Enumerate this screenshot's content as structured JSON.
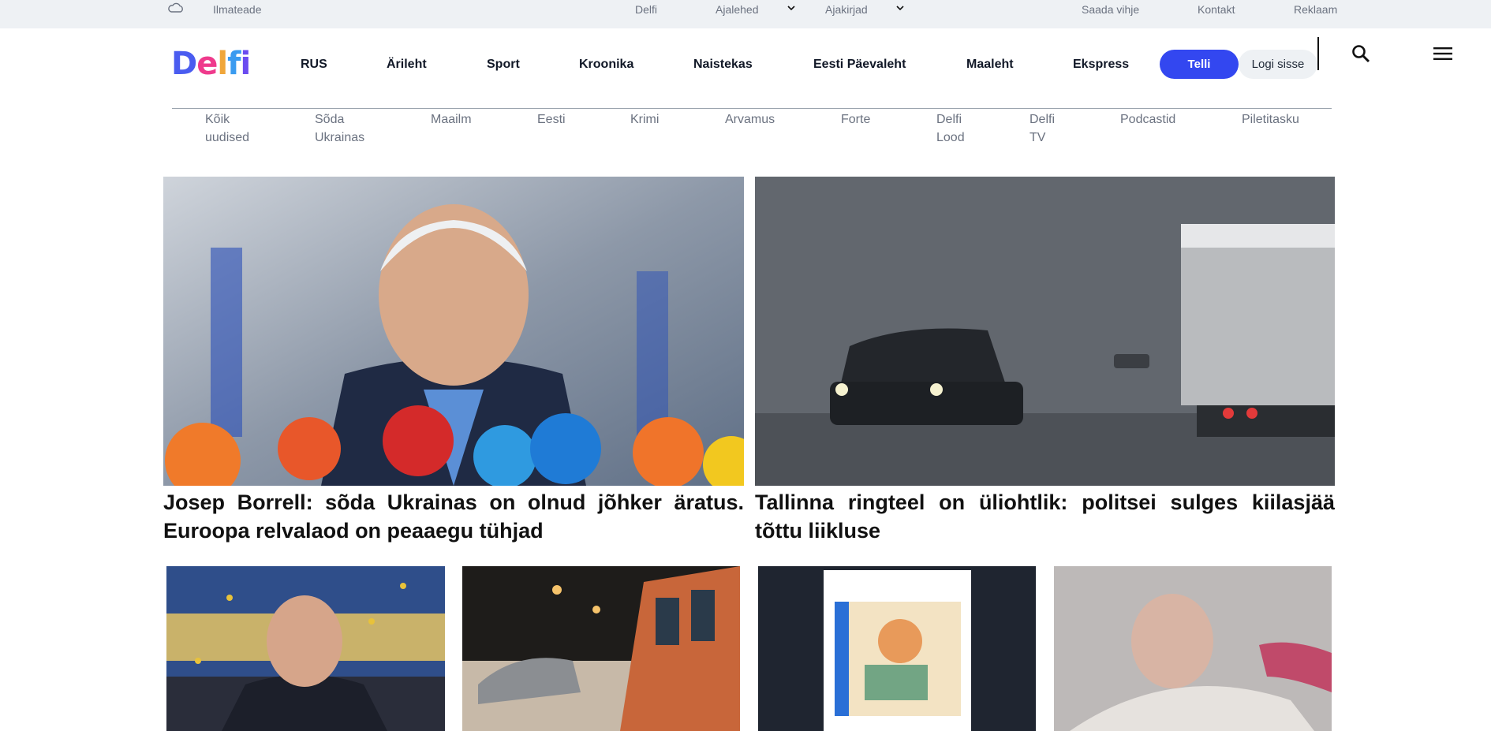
{
  "topbar": {
    "weather": "Ilmateade",
    "delfi": "Delfi",
    "ajalehed": "Ajalehed",
    "ajakirjad": "Ajakirjad",
    "saada_vihje": "Saada vihje",
    "kontakt": "Kontakt",
    "reklaam": "Reklaam"
  },
  "logo": {
    "d": "D",
    "e": "e",
    "l": "l",
    "f": "f",
    "i": "i"
  },
  "nav": {
    "items": [
      "RUS",
      "Ärileht",
      "Sport",
      "Kroonika",
      "Naistekas",
      "Eesti Päevaleht",
      "Maaleht",
      "Ekspress"
    ],
    "subscribe": "Telli",
    "login": "Logi sisse"
  },
  "subnav": {
    "items": [
      [
        "Kõik",
        "uudised"
      ],
      [
        "Sõda",
        "Ukrainas"
      ],
      [
        "Maailm"
      ],
      [
        "Eesti"
      ],
      [
        "Krimi"
      ],
      [
        "Arvamus"
      ],
      [
        "Forte"
      ],
      [
        "Delfi",
        "Lood"
      ],
      [
        "Delfi",
        "TV"
      ],
      [
        "Podcastid"
      ],
      [
        "Piletitasku"
      ]
    ]
  },
  "articles": {
    "a1": {
      "headline": "Josep Borrell: sõda Ukrainas on olnud jõhker äratus. Euroopa relvalaod on peaaegu tühjad"
    },
    "a2": {
      "headline": "Tallinna ringteel on üliohtlik: politsei sulges kiilasjää tõttu liikluse"
    }
  },
  "icons": {
    "weather": "cloud-icon",
    "search": "search-icon",
    "menu": "hamburger-menu-icon",
    "chevron": "chevron-down-icon"
  },
  "colors": {
    "accent": "#3347f0",
    "topbar_bg": "#eef1f4"
  }
}
